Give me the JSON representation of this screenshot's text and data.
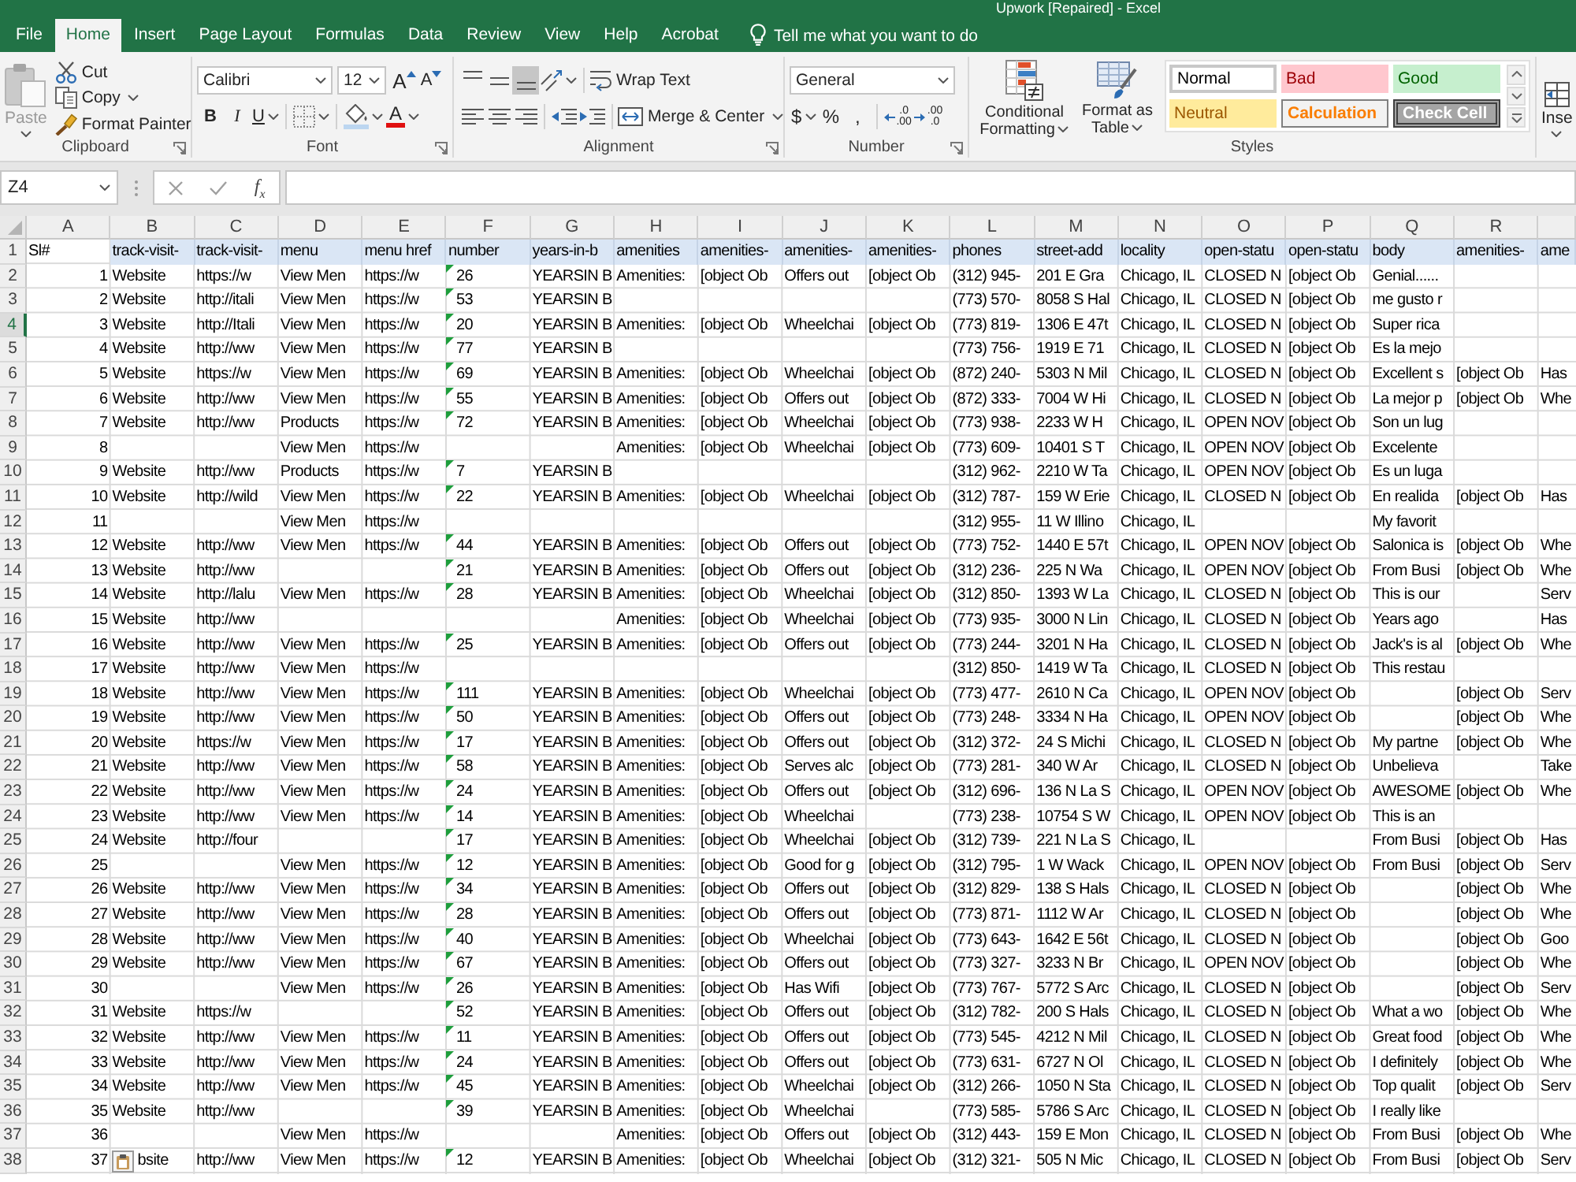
{
  "window": {
    "title": "Upwork [Repaired] - Excel"
  },
  "tabs": [
    {
      "label": "File",
      "selected": false
    },
    {
      "label": "Home",
      "selected": true
    },
    {
      "label": "Insert",
      "selected": false
    },
    {
      "label": "Page Layout",
      "selected": false
    },
    {
      "label": "Formulas",
      "selected": false
    },
    {
      "label": "Data",
      "selected": false
    },
    {
      "label": "Review",
      "selected": false
    },
    {
      "label": "View",
      "selected": false
    },
    {
      "label": "Help",
      "selected": false
    },
    {
      "label": "Acrobat",
      "selected": false
    }
  ],
  "tell_me": {
    "placeholder": "Tell me what you want to do"
  },
  "ribbon": {
    "clipboard": {
      "label": "Clipboard",
      "paste": {
        "label": "Paste",
        "disabled": true
      },
      "cut": "Cut",
      "copy": "Copy",
      "format_painter": "Format Painter"
    },
    "font": {
      "label": "Font",
      "font_name": "Calibri",
      "font_size": "12",
      "grow_font": "A",
      "shrink_font": "A",
      "styles": [
        {
          "label": "B",
          "kind": "bold"
        },
        {
          "label": "I",
          "kind": "italic"
        },
        {
          "label": "U",
          "kind": "underline"
        }
      ],
      "font_color": "A"
    },
    "alignment": {
      "label": "Alignment",
      "vertical": [
        {
          "kind": "top",
          "selected": false
        },
        {
          "kind": "middle",
          "selected": false
        },
        {
          "kind": "bottom",
          "selected": true
        }
      ],
      "horizontal": [
        {
          "kind": "left",
          "selected": false
        },
        {
          "kind": "center",
          "selected": false
        },
        {
          "kind": "right",
          "selected": false
        }
      ],
      "wrap_text": "Wrap Text",
      "merge_center": "Merge & Center"
    },
    "number": {
      "label": "Number",
      "format": "General",
      "currency": "$",
      "percent": "%",
      "comma": ",",
      "increase_decimal": [
        ".0",
        ".00"
      ],
      "decrease_decimal": [
        ".00",
        ".0"
      ]
    },
    "styles": {
      "label": "Styles",
      "conditional_formatting": "Conditional Formatting",
      "format_as_table": "Format as Table",
      "cell_styles": [
        {
          "label": "Normal",
          "kind": "normal"
        },
        {
          "label": "Bad",
          "kind": "bad"
        },
        {
          "label": "Good",
          "kind": "good"
        },
        {
          "label": "Neutral",
          "kind": "neutral"
        },
        {
          "label": "Calculation",
          "kind": "calculation"
        },
        {
          "label": "Check Cell",
          "kind": "check"
        }
      ]
    },
    "cells": {
      "insert": "Inse"
    }
  },
  "formula_bar": {
    "name_box": "Z4",
    "function_button": "f$_{x}$"
  },
  "sheet": {
    "columns": [
      "A",
      "B",
      "C",
      "D",
      "E",
      "F",
      "G",
      "H",
      "I",
      "J",
      "K",
      "L",
      "M",
      "N",
      "O",
      "P",
      "Q",
      "R"
    ],
    "rows": [
      {
        "number": "1",
        "selected": false,
        "cells": {
          "A": "Sl#",
          "B": {
            "text": "track-visit-",
            "filled": true
          },
          "C": {
            "text": "track-visit-",
            "filled": true
          },
          "D": {
            "text": "menu",
            "filled": true
          },
          "E": {
            "text": "menu href",
            "filled": true
          },
          "F": {
            "text": "number",
            "filled": true
          },
          "G": {
            "text": "years-in-b",
            "filled": true
          },
          "H": {
            "text": "amenities",
            "filled": true
          },
          "I": {
            "text": "amenities-",
            "filled": true
          },
          "J": {
            "text": "amenities-",
            "filled": true
          },
          "K": {
            "text": "amenities-",
            "filled": true
          },
          "L": {
            "text": "phones",
            "filled": true
          },
          "M": {
            "text": "street-add",
            "filled": true
          },
          "N": {
            "text": "locality",
            "filled": true
          },
          "O": {
            "text": "open-statu",
            "filled": true
          },
          "P": {
            "text": "open-statu",
            "filled": true
          },
          "Q": {
            "text": "body",
            "filled": true
          },
          "R": {
            "text": "amenities-",
            "filled": true
          },
          "S": {
            "text": "ame",
            "filled": true
          }
        }
      },
      {
        "number": "2",
        "selected": false,
        "cells": {
          "A": {
            "text": "1",
            "kind": "number"
          },
          "B": "Website",
          "C": "https://w",
          "D": "View Men",
          "E": "https://w",
          "F": {
            "text": "26",
            "kind": "number_text"
          },
          "G": "YEARSIN B",
          "H": "Amenities:",
          "I": "[object Ob",
          "J": "Offers out",
          "K": "[object Ob",
          "L": "(312) 945-",
          "M": "201 E Gra",
          "N": "Chicago, IL",
          "O": "CLOSED N",
          "P": "[object Ob",
          "Q": "Genial......"
        }
      },
      {
        "number": "3",
        "selected": false,
        "cells": {
          "A": {
            "text": "2",
            "kind": "number"
          },
          "B": "Website",
          "C": "http://itali",
          "D": "View Men",
          "E": "https://w",
          "F": {
            "text": "53",
            "kind": "number_text"
          },
          "G": "YEARSIN B",
          "L": "(773) 570-",
          "M": "8058 S Hal",
          "N": "Chicago, IL",
          "O": "CLOSED N",
          "P": "[object Ob",
          "Q": "me gusto r"
        }
      },
      {
        "number": "4",
        "selected": true,
        "cells": {
          "A": {
            "text": "3",
            "kind": "number"
          },
          "B": "Website",
          "C": "http://Itali",
          "D": "View Men",
          "E": "https://w",
          "F": {
            "text": "20",
            "kind": "number_text"
          },
          "G": "YEARSIN B",
          "H": "Amenities:",
          "I": "[object Ob",
          "J": "Wheelchai",
          "K": "[object Ob",
          "L": "(773) 819-",
          "M": "1306 E 47t",
          "N": "Chicago, IL",
          "O": "CLOSED N",
          "P": "[object Ob",
          "Q": "Super rica"
        }
      },
      {
        "number": "5",
        "selected": false,
        "cells": {
          "A": {
            "text": "4",
            "kind": "number"
          },
          "B": "Website",
          "C": "http://ww",
          "D": "View Men",
          "E": "https://w",
          "F": {
            "text": "77",
            "kind": "number_text"
          },
          "G": "YEARSIN B",
          "L": "(773) 756-",
          "M": "1919 E 71",
          "N": "Chicago, IL",
          "O": "CLOSED N",
          "P": "[object Ob",
          "Q": "Es la mejo"
        }
      },
      {
        "number": "6",
        "selected": false,
        "cells": {
          "A": {
            "text": "5",
            "kind": "number"
          },
          "B": "Website",
          "C": "https://w",
          "D": "View Men",
          "E": "https://w",
          "F": {
            "text": "69",
            "kind": "number_text"
          },
          "G": "YEARSIN B",
          "H": "Amenities:",
          "I": "[object Ob",
          "J": "Wheelchai",
          "K": "[object Ob",
          "L": "(872) 240-",
          "M": "5303 N Mil",
          "N": "Chicago, IL",
          "O": "CLOSED N",
          "P": "[object Ob",
          "Q": "Excellent s",
          "R": "[object Ob",
          "S": "Has"
        }
      },
      {
        "number": "7",
        "selected": false,
        "cells": {
          "A": {
            "text": "6",
            "kind": "number"
          },
          "B": "Website",
          "C": "http://ww",
          "D": "View Men",
          "E": "https://w",
          "F": {
            "text": "55",
            "kind": "number_text"
          },
          "G": "YEARSIN B",
          "H": "Amenities:",
          "I": "[object Ob",
          "J": "Offers out",
          "K": "[object Ob",
          "L": "(872) 333-",
          "M": "7004 W Hi",
          "N": "Chicago, IL",
          "O": "CLOSED N",
          "P": "[object Ob",
          "Q": "La mejor p",
          "R": "[object Ob",
          "S": "Whe"
        }
      },
      {
        "number": "8",
        "selected": false,
        "cells": {
          "A": {
            "text": "7",
            "kind": "number"
          },
          "B": "Website",
          "C": "http://ww",
          "D": "Products",
          "E": "https://w",
          "F": {
            "text": "72",
            "kind": "number_text"
          },
          "G": "YEARSIN B",
          "H": "Amenities:",
          "I": "[object Ob",
          "J": "Wheelchai",
          "K": "[object Ob",
          "L": "(773) 938-",
          "M": "2233 W H",
          "N": "Chicago, IL",
          "O": "OPEN NOV",
          "P": "[object Ob",
          "Q": "Son un lug"
        }
      },
      {
        "number": "9",
        "selected": false,
        "cells": {
          "A": {
            "text": "8",
            "kind": "number"
          },
          "D": "View Men",
          "E": "https://w",
          "H": "Amenities:",
          "I": "[object Ob",
          "J": "Wheelchai",
          "K": "[object Ob",
          "L": "(773) 609-",
          "M": "10401 S T",
          "N": "Chicago, IL",
          "O": "OPEN NOV",
          "P": "[object Ob",
          "Q": "Excelente"
        }
      },
      {
        "number": "10",
        "selected": false,
        "cells": {
          "A": {
            "text": "9",
            "kind": "number"
          },
          "B": "Website",
          "C": "http://ww",
          "D": "Products",
          "E": "https://w",
          "F": {
            "text": "7",
            "kind": "number_text"
          },
          "G": "YEARSIN B",
          "L": "(312) 962-",
          "M": "2210 W Ta",
          "N": "Chicago, IL",
          "O": "OPEN NOV",
          "P": "[object Ob",
          "Q": "Es un luga"
        }
      },
      {
        "number": "11",
        "selected": false,
        "cells": {
          "A": {
            "text": "10",
            "kind": "number"
          },
          "B": "Website",
          "C": "http://wild",
          "D": "View Men",
          "E": "https://w",
          "F": {
            "text": "22",
            "kind": "number_text"
          },
          "G": "YEARSIN B",
          "H": "Amenities:",
          "I": "[object Ob",
          "J": "Wheelchai",
          "K": "[object Ob",
          "L": "(312) 787-",
          "M": "159 W Erie",
          "N": "Chicago, IL",
          "O": "CLOSED N",
          "P": "[object Ob",
          "Q": "En realida",
          "R": "[object Ob",
          "S": "Has"
        }
      },
      {
        "number": "12",
        "selected": false,
        "cells": {
          "A": {
            "text": "11",
            "kind": "number"
          },
          "D": "View Men",
          "E": "https://w",
          "L": "(312) 955-",
          "M": "11 W Illino",
          "N": "Chicago, IL",
          "Q": "My favorit"
        }
      },
      {
        "number": "13",
        "selected": false,
        "cells": {
          "A": {
            "text": "12",
            "kind": "number"
          },
          "B": "Website",
          "C": "http://ww",
          "D": "View Men",
          "E": "https://w",
          "F": {
            "text": "44",
            "kind": "number_text"
          },
          "G": "YEARSIN B",
          "H": "Amenities:",
          "I": "[object Ob",
          "J": "Offers out",
          "K": "[object Ob",
          "L": "(773) 752-",
          "M": "1440 E 57t",
          "N": "Chicago, IL",
          "O": "OPEN NOV",
          "P": "[object Ob",
          "Q": "Salonica is",
          "R": "[object Ob",
          "S": "Whe"
        }
      },
      {
        "number": "14",
        "selected": false,
        "cells": {
          "A": {
            "text": "13",
            "kind": "number"
          },
          "B": "Website",
          "C": "http://ww",
          "F": {
            "text": "21",
            "kind": "number_text"
          },
          "G": "YEARSIN B",
          "H": "Amenities:",
          "I": "[object Ob",
          "J": "Offers out",
          "K": "[object Ob",
          "L": "(312) 236-",
          "M": "225 N Wa",
          "N": "Chicago, IL",
          "O": "OPEN NOV",
          "P": "[object Ob",
          "Q": "From Busi",
          "R": "[object Ob",
          "S": "Whe"
        }
      },
      {
        "number": "15",
        "selected": false,
        "cells": {
          "A": {
            "text": "14",
            "kind": "number"
          },
          "B": "Website",
          "C": "http://lalu",
          "D": "View Men",
          "E": "https://w",
          "F": {
            "text": "28",
            "kind": "number_text"
          },
          "G": "YEARSIN B",
          "H": "Amenities:",
          "I": "[object Ob",
          "J": "Wheelchai",
          "K": "[object Ob",
          "L": "(312) 850-",
          "M": "1393 W La",
          "N": "Chicago, IL",
          "O": "CLOSED N",
          "P": "[object Ob",
          "Q": "This is our",
          "S": "Serv"
        }
      },
      {
        "number": "16",
        "selected": false,
        "cells": {
          "A": {
            "text": "15",
            "kind": "number"
          },
          "B": "Website",
          "C": "http://ww",
          "H": "Amenities:",
          "I": "[object Ob",
          "J": "Wheelchai",
          "K": "[object Ob",
          "L": "(773) 935-",
          "M": "3000 N Lin",
          "N": "Chicago, IL",
          "O": "CLOSED N",
          "P": "[object Ob",
          "Q": "Years ago",
          "S": "Has"
        }
      },
      {
        "number": "17",
        "selected": false,
        "cells": {
          "A": {
            "text": "16",
            "kind": "number"
          },
          "B": "Website",
          "C": "http://ww",
          "D": "View Men",
          "E": "https://w",
          "F": {
            "text": "25",
            "kind": "number_text"
          },
          "G": "YEARSIN B",
          "H": "Amenities:",
          "I": "[object Ob",
          "J": "Offers out",
          "K": "[object Ob",
          "L": "(773) 244-",
          "M": "3201 N Ha",
          "N": "Chicago, IL",
          "O": "CLOSED N",
          "P": "[object Ob",
          "Q": "Jack's is al",
          "R": "[object Ob",
          "S": "Whe"
        }
      },
      {
        "number": "18",
        "selected": false,
        "cells": {
          "A": {
            "text": "17",
            "kind": "number"
          },
          "B": "Website",
          "C": "http://ww",
          "D": "View Men",
          "E": "https://w",
          "L": "(312) 850-",
          "M": "1419 W Ta",
          "N": "Chicago, IL",
          "O": "CLOSED N",
          "P": "[object Ob",
          "Q": "This restau"
        }
      },
      {
        "number": "19",
        "selected": false,
        "cells": {
          "A": {
            "text": "18",
            "kind": "number"
          },
          "B": "Website",
          "C": "http://ww",
          "D": "View Men",
          "E": "https://w",
          "F": {
            "text": "111",
            "kind": "number_text"
          },
          "G": "YEARSIN B",
          "H": "Amenities:",
          "I": "[object Ob",
          "J": "Wheelchai",
          "K": "[object Ob",
          "L": "(773) 477-",
          "M": "2610 N Ca",
          "N": "Chicago, IL",
          "O": "OPEN NOV",
          "P": "[object Ob",
          "R": "[object Ob",
          "S": "Serv"
        }
      },
      {
        "number": "20",
        "selected": false,
        "cells": {
          "A": {
            "text": "19",
            "kind": "number"
          },
          "B": "Website",
          "C": "http://ww",
          "D": "View Men",
          "E": "https://w",
          "F": {
            "text": "50",
            "kind": "number_text"
          },
          "G": "YEARSIN B",
          "H": "Amenities:",
          "I": "[object Ob",
          "J": "Offers out",
          "K": "[object Ob",
          "L": "(773) 248-",
          "M": "3334 N Ha",
          "N": "Chicago, IL",
          "O": "OPEN NOV",
          "P": "[object Ob",
          "R": "[object Ob",
          "S": "Whe"
        }
      },
      {
        "number": "21",
        "selected": false,
        "cells": {
          "A": {
            "text": "20",
            "kind": "number"
          },
          "B": "Website",
          "C": "https://w",
          "D": "View Men",
          "E": "https://w",
          "F": {
            "text": "17",
            "kind": "number_text"
          },
          "G": "YEARSIN B",
          "H": "Amenities:",
          "I": "[object Ob",
          "J": "Offers out",
          "K": "[object Ob",
          "L": "(312) 372-",
          "M": "24 S Michi",
          "N": "Chicago, IL",
          "O": "CLOSED N",
          "P": "[object Ob",
          "Q": "My partne",
          "R": "[object Ob",
          "S": "Whe"
        }
      },
      {
        "number": "22",
        "selected": false,
        "cells": {
          "A": {
            "text": "21",
            "kind": "number"
          },
          "B": "Website",
          "C": "http://ww",
          "D": "View Men",
          "E": "https://w",
          "F": {
            "text": "58",
            "kind": "number_text"
          },
          "G": "YEARSIN B",
          "H": "Amenities:",
          "I": "[object Ob",
          "J": "Serves alc",
          "K": "[object Ob",
          "L": "(773) 281-",
          "M": "340 W Ar",
          "N": "Chicago, IL",
          "O": "CLOSED N",
          "P": "[object Ob",
          "Q": "Unbelieva",
          "S": "Take"
        }
      },
      {
        "number": "23",
        "selected": false,
        "cells": {
          "A": {
            "text": "22",
            "kind": "number"
          },
          "B": "Website",
          "C": "http://ww",
          "D": "View Men",
          "E": "https://w",
          "F": {
            "text": "24",
            "kind": "number_text"
          },
          "G": "YEARSIN B",
          "H": "Amenities:",
          "I": "[object Ob",
          "J": "Offers out",
          "K": "[object Ob",
          "L": "(312) 696-",
          "M": "136 N La S",
          "N": "Chicago, IL",
          "O": "OPEN NOV",
          "P": "[object Ob",
          "Q": "AWESOME",
          "R": "[object Ob",
          "S": "Whe"
        }
      },
      {
        "number": "24",
        "selected": false,
        "cells": {
          "A": {
            "text": "23",
            "kind": "number"
          },
          "B": "Website",
          "C": "http://ww",
          "D": "View Men",
          "E": "https://w",
          "F": {
            "text": "14",
            "kind": "number_text"
          },
          "G": "YEARSIN B",
          "H": "Amenities:",
          "I": "[object Ob",
          "J": "Wheelchai",
          "L": "(773) 238-",
          "M": "10754 S W",
          "N": "Chicago, IL",
          "O": "OPEN NOV",
          "P": "[object Ob",
          "Q": "This is an"
        }
      },
      {
        "number": "25",
        "selected": false,
        "cells": {
          "A": {
            "text": "24",
            "kind": "number"
          },
          "B": "Website",
          "C": "http://four",
          "F": {
            "text": "17",
            "kind": "number_text"
          },
          "G": "YEARSIN B",
          "H": "Amenities:",
          "I": "[object Ob",
          "J": "Wheelchai",
          "K": "[object Ob",
          "L": "(312) 739-",
          "M": "221 N La S",
          "N": "Chicago, IL",
          "Q": "From Busi",
          "R": "[object Ob",
          "S": "Has"
        }
      },
      {
        "number": "26",
        "selected": false,
        "cells": {
          "A": {
            "text": "25",
            "kind": "number"
          },
          "D": "View Men",
          "E": "https://w",
          "F": {
            "text": "12",
            "kind": "number_text"
          },
          "G": "YEARSIN B",
          "H": "Amenities:",
          "I": "[object Ob",
          "J": "Good for g",
          "K": "[object Ob",
          "L": "(312) 795-",
          "M": "1 W Wack",
          "N": "Chicago, IL",
          "O": "OPEN NOV",
          "P": "[object Ob",
          "Q": "From Busi",
          "R": "[object Ob",
          "S": "Serv"
        }
      },
      {
        "number": "27",
        "selected": false,
        "cells": {
          "A": {
            "text": "26",
            "kind": "number"
          },
          "B": "Website",
          "C": "http://ww",
          "D": "View Men",
          "E": "https://w",
          "F": {
            "text": "34",
            "kind": "number_text"
          },
          "G": "YEARSIN B",
          "H": "Amenities:",
          "I": "[object Ob",
          "J": "Offers out",
          "K": "[object Ob",
          "L": "(312) 829-",
          "M": "138 S Hals",
          "N": "Chicago, IL",
          "O": "CLOSED N",
          "P": "[object Ob",
          "R": "[object Ob",
          "S": "Whe"
        }
      },
      {
        "number": "28",
        "selected": false,
        "cells": {
          "A": {
            "text": "27",
            "kind": "number"
          },
          "B": "Website",
          "C": "http://ww",
          "D": "View Men",
          "E": "https://w",
          "F": {
            "text": "28",
            "kind": "number_text"
          },
          "G": "YEARSIN B",
          "H": "Amenities:",
          "I": "[object Ob",
          "J": "Offers out",
          "K": "[object Ob",
          "L": "(773) 871-",
          "M": "1112 W Ar",
          "N": "Chicago, IL",
          "O": "CLOSED N",
          "P": "[object Ob",
          "R": "[object Ob",
          "S": "Whe"
        }
      },
      {
        "number": "29",
        "selected": false,
        "cells": {
          "A": {
            "text": "28",
            "kind": "number"
          },
          "B": "Website",
          "C": "http://ww",
          "D": "View Men",
          "E": "https://w",
          "F": {
            "text": "40",
            "kind": "number_text"
          },
          "G": "YEARSIN B",
          "H": "Amenities:",
          "I": "[object Ob",
          "J": "Wheelchai",
          "K": "[object Ob",
          "L": "(773) 643-",
          "M": "1642 E 56t",
          "N": "Chicago, IL",
          "O": "CLOSED N",
          "P": "[object Ob",
          "R": "[object Ob",
          "S": "Goo"
        }
      },
      {
        "number": "30",
        "selected": false,
        "cells": {
          "A": {
            "text": "29",
            "kind": "number"
          },
          "B": "Website",
          "C": "http://ww",
          "D": "View Men",
          "E": "https://w",
          "F": {
            "text": "67",
            "kind": "number_text"
          },
          "G": "YEARSIN B",
          "H": "Amenities:",
          "I": "[object Ob",
          "J": "Offers out",
          "K": "[object Ob",
          "L": "(773) 327-",
          "M": "3233 N Br",
          "N": "Chicago, IL",
          "O": "OPEN NOV",
          "P": "[object Ob",
          "R": "[object Ob",
          "S": "Whe"
        }
      },
      {
        "number": "31",
        "selected": false,
        "cells": {
          "A": {
            "text": "30",
            "kind": "number"
          },
          "D": "View Men",
          "E": "https://w",
          "F": {
            "text": "26",
            "kind": "number_text"
          },
          "G": "YEARSIN B",
          "H": "Amenities:",
          "I": "[object Ob",
          "J": "Has Wifi",
          "K": "[object Ob",
          "L": "(773) 767-",
          "M": "5772 S Arc",
          "N": "Chicago, IL",
          "O": "CLOSED N",
          "P": "[object Ob",
          "R": "[object Ob",
          "S": "Serv"
        }
      },
      {
        "number": "32",
        "selected": false,
        "cells": {
          "A": {
            "text": "31",
            "kind": "number"
          },
          "B": "Website",
          "C": "https://w",
          "F": {
            "text": "52",
            "kind": "number_text"
          },
          "G": "YEARSIN B",
          "H": "Amenities:",
          "I": "[object Ob",
          "J": "Offers out",
          "K": "[object Ob",
          "L": "(312) 782-",
          "M": "200 S Hals",
          "N": "Chicago, IL",
          "O": "CLOSED N",
          "P": "[object Ob",
          "Q": "What a wo",
          "R": "[object Ob",
          "S": "Whe"
        }
      },
      {
        "number": "33",
        "selected": false,
        "cells": {
          "A": {
            "text": "32",
            "kind": "number"
          },
          "B": "Website",
          "C": "http://ww",
          "D": "View Men",
          "E": "https://w",
          "F": {
            "text": "11",
            "kind": "number_text"
          },
          "G": "YEARSIN B",
          "H": "Amenities:",
          "I": "[object Ob",
          "J": "Offers out",
          "K": "[object Ob",
          "L": "(773) 545-",
          "M": "4212 N Mil",
          "N": "Chicago, IL",
          "O": "CLOSED N",
          "P": "[object Ob",
          "Q": "Great food",
          "R": "[object Ob",
          "S": "Whe"
        }
      },
      {
        "number": "34",
        "selected": false,
        "cells": {
          "A": {
            "text": "33",
            "kind": "number"
          },
          "B": "Website",
          "C": "http://ww",
          "D": "View Men",
          "E": "https://w",
          "F": {
            "text": "24",
            "kind": "number_text"
          },
          "G": "YEARSIN B",
          "H": "Amenities:",
          "I": "[object Ob",
          "J": "Offers out",
          "K": "[object Ob",
          "L": "(773) 631-",
          "M": "6727 N Ol",
          "N": "Chicago, IL",
          "O": "CLOSED N",
          "P": "[object Ob",
          "Q": "I definitely",
          "R": "[object Ob",
          "S": "Whe"
        }
      },
      {
        "number": "35",
        "selected": false,
        "cells": {
          "A": {
            "text": "34",
            "kind": "number"
          },
          "B": "Website",
          "C": "http://ww",
          "D": "View Men",
          "E": "https://w",
          "F": {
            "text": "45",
            "kind": "number_text"
          },
          "G": "YEARSIN B",
          "H": "Amenities:",
          "I": "[object Ob",
          "J": "Wheelchai",
          "K": "[object Ob",
          "L": "(312) 266-",
          "M": "1050 N Sta",
          "N": "Chicago, IL",
          "O": "CLOSED N",
          "P": "[object Ob",
          "Q": "Top qualit",
          "R": "[object Ob",
          "S": "Serv"
        }
      },
      {
        "number": "36",
        "selected": false,
        "cells": {
          "A": {
            "text": "35",
            "kind": "number"
          },
          "B": "Website",
          "C": "http://ww",
          "F": {
            "text": "39",
            "kind": "number_text"
          },
          "G": "YEARSIN B",
          "H": "Amenities:",
          "I": "[object Ob",
          "J": "Wheelchai",
          "L": "(773) 585-",
          "M": "5786 S Arc",
          "N": "Chicago, IL",
          "O": "CLOSED N",
          "P": "[object Ob",
          "Q": "I really like"
        }
      },
      {
        "number": "37",
        "selected": false,
        "cells": {
          "A": {
            "text": "36",
            "kind": "number"
          },
          "D": "View Men",
          "E": "https://w",
          "H": "Amenities:",
          "I": "[object Ob",
          "J": "Offers out",
          "K": "[object Ob",
          "L": "(312) 443-",
          "M": "159 E Mon",
          "N": "Chicago, IL",
          "O": "CLOSED N",
          "P": "[object Ob",
          "Q": "From Busi",
          "R": "[object Ob",
          "S": "Whe"
        }
      },
      {
        "number": "38",
        "selected": false,
        "cells": {
          "A": {
            "text": "37",
            "kind": "number"
          },
          "B": {
            "text": "bsite",
            "paste_options": true
          },
          "C": "http://ww",
          "D": "View Men",
          "E": "https://w",
          "F": {
            "text": "12",
            "kind": "number_text"
          },
          "G": "YEARSIN B",
          "H": "Amenities:",
          "I": "[object Ob",
          "J": "Wheelchai",
          "K": "[object Ob",
          "L": "(312) 321-",
          "M": "505 N Mic",
          "N": "Chicago, IL",
          "O": "CLOSED N",
          "P": "[object Ob",
          "Q": "From Busi",
          "R": "[object Ob",
          "S": "Serv"
        }
      }
    ]
  }
}
